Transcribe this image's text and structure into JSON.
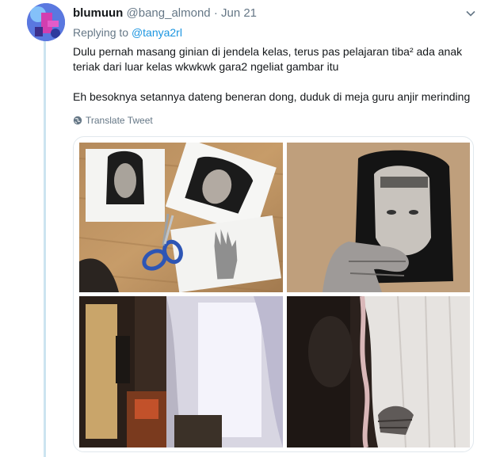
{
  "tweet": {
    "author_name": "blumuun",
    "handle": "@bang_almond",
    "separator": "·",
    "date": "Jun 21",
    "caret": "⌄",
    "reply_prefix": "Replying to",
    "reply_mention": "@tanya2rl",
    "body_line_1": "Dulu pernah masang ginian di jendela kelas, terus pas pelajaran tiba² ada anak",
    "body_line_2": "teriak dari luar kelas wkwkwk gara2 ngeliat gambar itu",
    "body_line_3": "Eh besoknya setannya dateng beneran dong, duduk di meja guru anjir merinding",
    "translate_label": "Translate Tweet"
  },
  "icons": {
    "caret": "chevron-down-icon",
    "translate": "globe-icon"
  },
  "colors": {
    "link": "#1b95e0",
    "secondary_text": "#657786",
    "primary_text": "#14171a",
    "thread_line": "#cce4f0"
  }
}
